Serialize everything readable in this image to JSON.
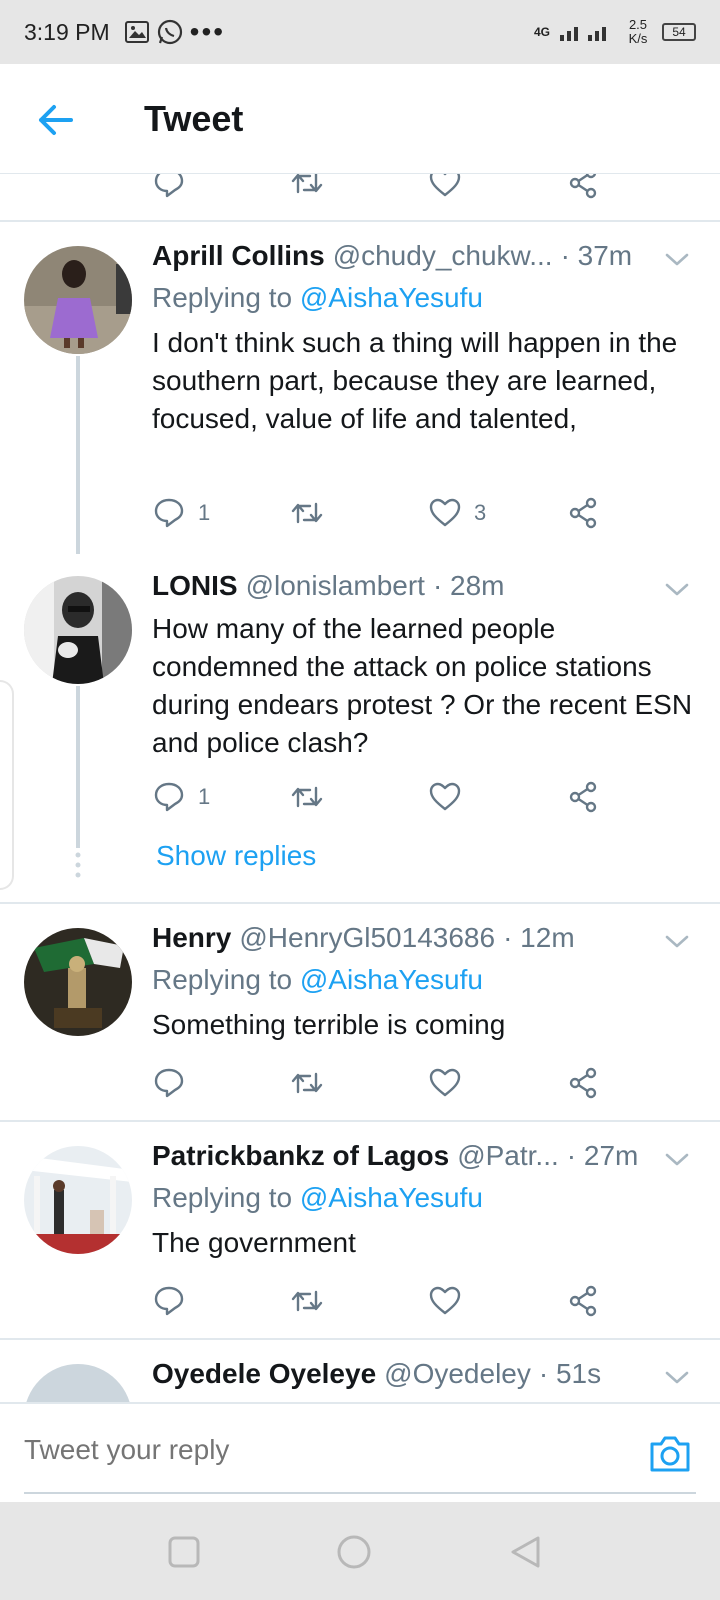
{
  "status_bar": {
    "time": "3:19 PM",
    "network": "4G",
    "speed": "2.5 K/s",
    "battery": "54"
  },
  "header": {
    "title": "Tweet"
  },
  "tweets": [
    {
      "name": "Aprill Collins",
      "handle": "@chudy_chukw...",
      "time": "· 37m",
      "replying_prefix": "Replying to",
      "replying_to": "@AishaYesufu",
      "text": "I don't think such a thing will happen in the southern part, because they are learned, focused, value of life  and talented,",
      "replies": "1",
      "likes": "3"
    },
    {
      "name": "LONIS",
      "handle": "@lonislambert",
      "time": "· 28m",
      "text": "How many of the learned people condemned the attack on police stations during endears protest ? Or the recent ESN and police clash?",
      "replies": "1",
      "show_replies": "Show replies"
    },
    {
      "name": "Henry",
      "handle": "@HenryGl50143686",
      "time": "· 12m",
      "replying_prefix": "Replying to",
      "replying_to": "@AishaYesufu",
      "text": "Something terrible is coming"
    },
    {
      "name": "Patrickbankz of Lagos",
      "handle": "@Patr...",
      "time": "· 27m",
      "replying_prefix": "Replying to",
      "replying_to": "@AishaYesufu",
      "text": "The government"
    },
    {
      "name": "Oyedele Oyeleye",
      "handle": "@Oyedeley",
      "time": "· 51s"
    }
  ],
  "reply_bar": {
    "placeholder": "Tweet your reply"
  },
  "colors": {
    "accent": "#1da1f2",
    "secondary_text": "#657786",
    "divider": "#e1e8ed"
  }
}
